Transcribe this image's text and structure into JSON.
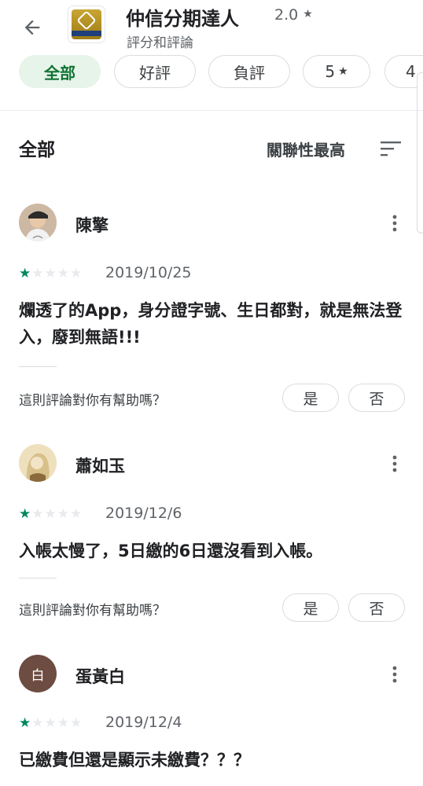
{
  "header": {
    "title": "仲信分期達人",
    "rating": "2.0",
    "rating_star": "★",
    "subtitle": "評分和評論"
  },
  "filters": [
    {
      "label": "全部",
      "selected": true
    },
    {
      "label": "好評",
      "selected": false
    },
    {
      "label": "負評",
      "selected": false
    },
    {
      "label": "5",
      "star": "★",
      "selected": false
    },
    {
      "label": "4",
      "selected": false
    }
  ],
  "section": {
    "title": "全部",
    "sort_label": "關聯性最高"
  },
  "reviews": [
    {
      "name": "陳擎",
      "stars": 1,
      "date": "2019/10/25",
      "text": "爛透了的App，身分證字號、生日都對，就是無法登入，廢到無語!!!",
      "helpful_question": "這則評論對你有幫助嗎？",
      "yes": "是",
      "no": "否"
    },
    {
      "name": "蕭如玉",
      "stars": 1,
      "date": "2019/12/6",
      "text": "入帳太慢了，5日繳的6日還沒看到入帳。",
      "helpful_question": "這則評論對你有幫助嗎？",
      "yes": "是",
      "no": "否"
    },
    {
      "name": "蛋黃白",
      "avatar_letter": "白",
      "stars": 1,
      "date": "2019/12/4",
      "text": "已繳費但還是顯示未繳費？？？"
    }
  ],
  "colors": {
    "accent_green": "#01875f",
    "chip_selected_bg": "#e6f4ea",
    "chip_selected_text": "#137333"
  }
}
